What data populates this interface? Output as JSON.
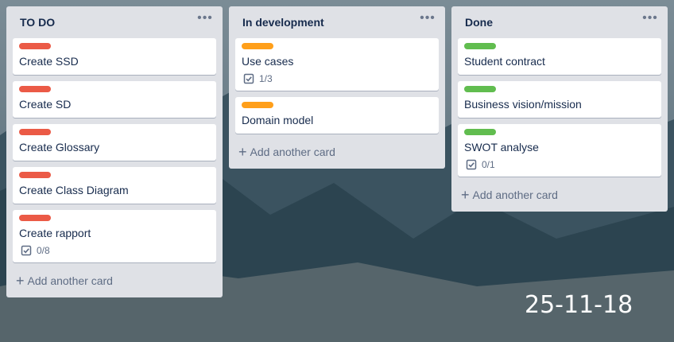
{
  "colors": {
    "red": "#eb5a46",
    "orange": "#ff9f1a",
    "green": "#61bd4f"
  },
  "lists": [
    {
      "title": "TO DO",
      "menu": "•••",
      "add_card": "Add another card",
      "cards": [
        {
          "title": "Create SSD",
          "label": "red"
        },
        {
          "title": "Create SD",
          "label": "red"
        },
        {
          "title": "Create Glossary",
          "label": "red"
        },
        {
          "title": "Create Class Diagram",
          "label": "red"
        },
        {
          "title": "Create rapport",
          "label": "red",
          "checklist": "0/8"
        }
      ]
    },
    {
      "title": "In development",
      "menu": "•••",
      "add_card": "Add another card",
      "cards": [
        {
          "title": "Use cases",
          "label": "orange",
          "checklist": "1/3"
        },
        {
          "title": "Domain model",
          "label": "orange"
        }
      ]
    },
    {
      "title": "Done",
      "menu": "•••",
      "add_card": "Add another card",
      "cards": [
        {
          "title": "Student contract",
          "label": "green"
        },
        {
          "title": "Business vision/mission",
          "label": "green"
        },
        {
          "title": "SWOT analyse",
          "label": "green",
          "checklist": "0/1"
        }
      ]
    }
  ],
  "date_text": "25-11-18"
}
